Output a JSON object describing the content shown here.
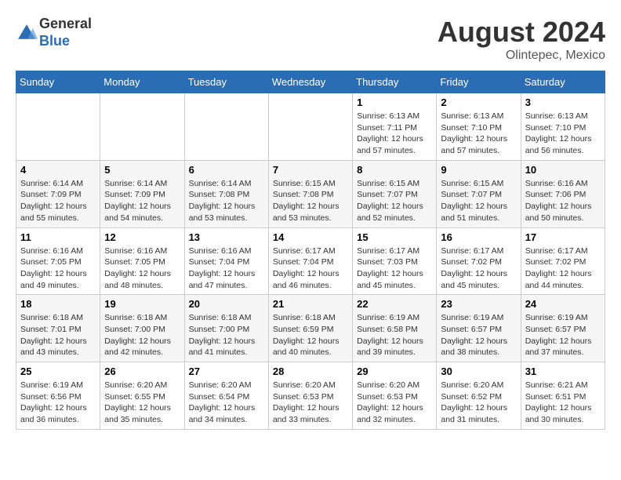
{
  "header": {
    "logo_line1": "General",
    "logo_line2": "Blue",
    "month_year": "August 2024",
    "location": "Olintepec, Mexico"
  },
  "weekdays": [
    "Sunday",
    "Monday",
    "Tuesday",
    "Wednesday",
    "Thursday",
    "Friday",
    "Saturday"
  ],
  "weeks": [
    [
      {
        "day": "",
        "info": ""
      },
      {
        "day": "",
        "info": ""
      },
      {
        "day": "",
        "info": ""
      },
      {
        "day": "",
        "info": ""
      },
      {
        "day": "1",
        "info": "Sunrise: 6:13 AM\nSunset: 7:11 PM\nDaylight: 12 hours and 57 minutes."
      },
      {
        "day": "2",
        "info": "Sunrise: 6:13 AM\nSunset: 7:10 PM\nDaylight: 12 hours and 57 minutes."
      },
      {
        "day": "3",
        "info": "Sunrise: 6:13 AM\nSunset: 7:10 PM\nDaylight: 12 hours and 56 minutes."
      }
    ],
    [
      {
        "day": "4",
        "info": "Sunrise: 6:14 AM\nSunset: 7:09 PM\nDaylight: 12 hours and 55 minutes."
      },
      {
        "day": "5",
        "info": "Sunrise: 6:14 AM\nSunset: 7:09 PM\nDaylight: 12 hours and 54 minutes."
      },
      {
        "day": "6",
        "info": "Sunrise: 6:14 AM\nSunset: 7:08 PM\nDaylight: 12 hours and 53 minutes."
      },
      {
        "day": "7",
        "info": "Sunrise: 6:15 AM\nSunset: 7:08 PM\nDaylight: 12 hours and 53 minutes."
      },
      {
        "day": "8",
        "info": "Sunrise: 6:15 AM\nSunset: 7:07 PM\nDaylight: 12 hours and 52 minutes."
      },
      {
        "day": "9",
        "info": "Sunrise: 6:15 AM\nSunset: 7:07 PM\nDaylight: 12 hours and 51 minutes."
      },
      {
        "day": "10",
        "info": "Sunrise: 6:16 AM\nSunset: 7:06 PM\nDaylight: 12 hours and 50 minutes."
      }
    ],
    [
      {
        "day": "11",
        "info": "Sunrise: 6:16 AM\nSunset: 7:05 PM\nDaylight: 12 hours and 49 minutes."
      },
      {
        "day": "12",
        "info": "Sunrise: 6:16 AM\nSunset: 7:05 PM\nDaylight: 12 hours and 48 minutes."
      },
      {
        "day": "13",
        "info": "Sunrise: 6:16 AM\nSunset: 7:04 PM\nDaylight: 12 hours and 47 minutes."
      },
      {
        "day": "14",
        "info": "Sunrise: 6:17 AM\nSunset: 7:04 PM\nDaylight: 12 hours and 46 minutes."
      },
      {
        "day": "15",
        "info": "Sunrise: 6:17 AM\nSunset: 7:03 PM\nDaylight: 12 hours and 45 minutes."
      },
      {
        "day": "16",
        "info": "Sunrise: 6:17 AM\nSunset: 7:02 PM\nDaylight: 12 hours and 45 minutes."
      },
      {
        "day": "17",
        "info": "Sunrise: 6:17 AM\nSunset: 7:02 PM\nDaylight: 12 hours and 44 minutes."
      }
    ],
    [
      {
        "day": "18",
        "info": "Sunrise: 6:18 AM\nSunset: 7:01 PM\nDaylight: 12 hours and 43 minutes."
      },
      {
        "day": "19",
        "info": "Sunrise: 6:18 AM\nSunset: 7:00 PM\nDaylight: 12 hours and 42 minutes."
      },
      {
        "day": "20",
        "info": "Sunrise: 6:18 AM\nSunset: 7:00 PM\nDaylight: 12 hours and 41 minutes."
      },
      {
        "day": "21",
        "info": "Sunrise: 6:18 AM\nSunset: 6:59 PM\nDaylight: 12 hours and 40 minutes."
      },
      {
        "day": "22",
        "info": "Sunrise: 6:19 AM\nSunset: 6:58 PM\nDaylight: 12 hours and 39 minutes."
      },
      {
        "day": "23",
        "info": "Sunrise: 6:19 AM\nSunset: 6:57 PM\nDaylight: 12 hours and 38 minutes."
      },
      {
        "day": "24",
        "info": "Sunrise: 6:19 AM\nSunset: 6:57 PM\nDaylight: 12 hours and 37 minutes."
      }
    ],
    [
      {
        "day": "25",
        "info": "Sunrise: 6:19 AM\nSunset: 6:56 PM\nDaylight: 12 hours and 36 minutes."
      },
      {
        "day": "26",
        "info": "Sunrise: 6:20 AM\nSunset: 6:55 PM\nDaylight: 12 hours and 35 minutes."
      },
      {
        "day": "27",
        "info": "Sunrise: 6:20 AM\nSunset: 6:54 PM\nDaylight: 12 hours and 34 minutes."
      },
      {
        "day": "28",
        "info": "Sunrise: 6:20 AM\nSunset: 6:53 PM\nDaylight: 12 hours and 33 minutes."
      },
      {
        "day": "29",
        "info": "Sunrise: 6:20 AM\nSunset: 6:53 PM\nDaylight: 12 hours and 32 minutes."
      },
      {
        "day": "30",
        "info": "Sunrise: 6:20 AM\nSunset: 6:52 PM\nDaylight: 12 hours and 31 minutes."
      },
      {
        "day": "31",
        "info": "Sunrise: 6:21 AM\nSunset: 6:51 PM\nDaylight: 12 hours and 30 minutes."
      }
    ]
  ]
}
